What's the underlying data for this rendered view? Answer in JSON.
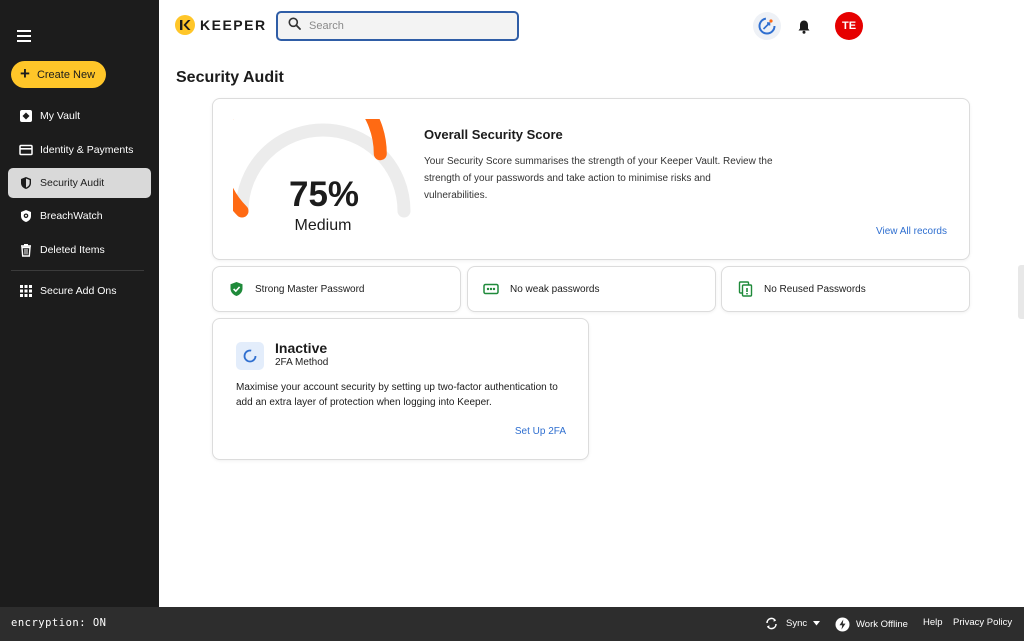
{
  "sidebar": {
    "create_label": "Create New",
    "items": [
      {
        "label": "My Vault",
        "icon": "vault-icon"
      },
      {
        "label": "Identity & Payments",
        "icon": "card-icon"
      },
      {
        "label": "Security Audit",
        "icon": "shield-icon",
        "active": true
      },
      {
        "label": "BreachWatch",
        "icon": "breachwatch-icon"
      },
      {
        "label": "Deleted Items",
        "icon": "trash-icon"
      },
      {
        "label": "Secure Add Ons",
        "icon": "grid-icon"
      }
    ]
  },
  "header": {
    "logo_text": "KEEPER",
    "search_placeholder": "Search",
    "avatar_initials": "TE"
  },
  "page": {
    "title": "Security Audit"
  },
  "score": {
    "percent": 75,
    "percent_text": "75%",
    "level": "Medium",
    "title": "Overall Security Score",
    "description": "Your Security Score summarises the strength of your Keeper Vault. Review the strength of your passwords and take action to minimise risks and vulnerabilities.",
    "link": "View All records",
    "colors": {
      "accent": "#ff6a13",
      "track": "#ececec"
    }
  },
  "stats": [
    {
      "label": "Strong Master Password",
      "icon": "shield-check-icon"
    },
    {
      "label": "No weak passwords",
      "icon": "password-dots-icon"
    },
    {
      "label": "No Reused Passwords",
      "icon": "duplicate-icon"
    }
  ],
  "twofa": {
    "status": "Inactive",
    "method": "2FA Method",
    "description": "Maximise your account security by setting up two-factor authentication to add an extra layer of protection when logging into Keeper.",
    "link": "Set Up 2FA"
  },
  "bottombar": {
    "encryption": "encryption: ON",
    "sync": "Sync",
    "work_offline": "Work Offline",
    "help": "Help",
    "privacy": "Privacy Policy"
  }
}
